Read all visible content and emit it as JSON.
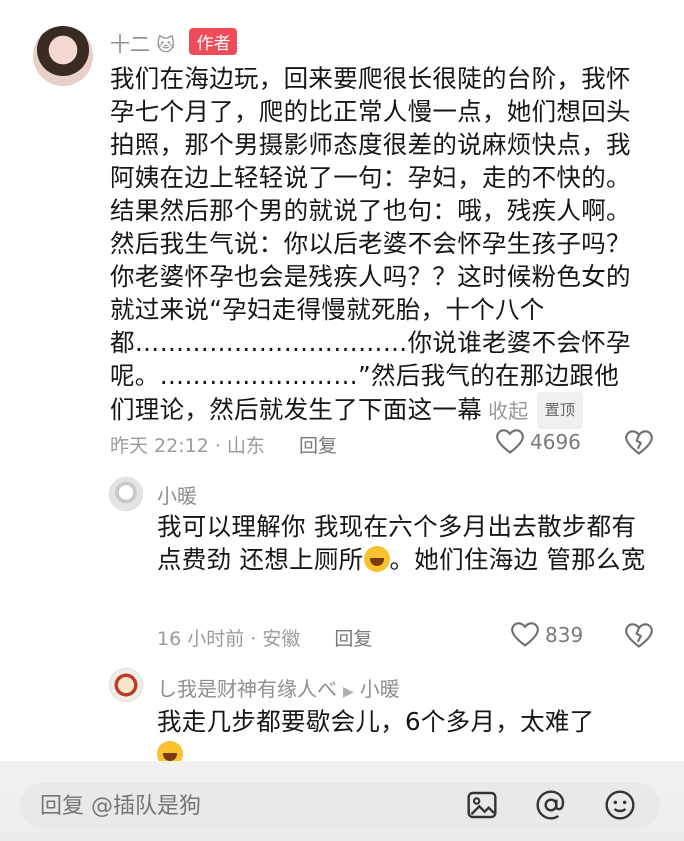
{
  "main_comment": {
    "username": "十二",
    "badge": "作者",
    "text": "我们在海边玩，回来要爬很长很陡的台阶，我怀孕七个月了，爬的比正常人慢一点，她们想回头拍照，那个男摄影师态度很差的说麻烦快点，我阿姨在边上轻轻说了一句：孕妇，走的不快的。结果然后那个男的就说了也句：哦，残疾人啊。然后我生气说：你以后老婆不会怀孕生孩子吗？你老婆怀孕也会是残疾人吗？？这时候粉色女的就过来说“孕妇走得慢就死胎，十个八个都……………………………你说谁老婆不会怀孕呢。……………………”然后我气的在那边跟他们理论，然后就发生了下面这一幕",
    "collapse_label": "收起",
    "pin_label": "置顶",
    "time_location": "昨天 22:12 · 山东",
    "reply_label": "回复",
    "likes": "4696"
  },
  "reply1": {
    "username": "小暖",
    "text_a": "我可以理解你 我现在六个多月出去散步都有点费劲 还想上厕所",
    "text_b": "。她们住海边 管那么宽",
    "time_location": "16 小时前 · 安徽",
    "reply_label": "回复",
    "likes": "839"
  },
  "reply2": {
    "username": "し我是财神有缘人べ",
    "reply_to": "小暖",
    "text": "我走几步都要歇会儿，6个多月，太难了"
  },
  "bottom_bar": {
    "placeholder": "回复 @插队是狗"
  },
  "icons": {
    "like": "heart-icon",
    "dislike": "broken-heart-icon",
    "image": "image-icon",
    "mention": "at-icon",
    "emoji": "emoji-icon"
  }
}
